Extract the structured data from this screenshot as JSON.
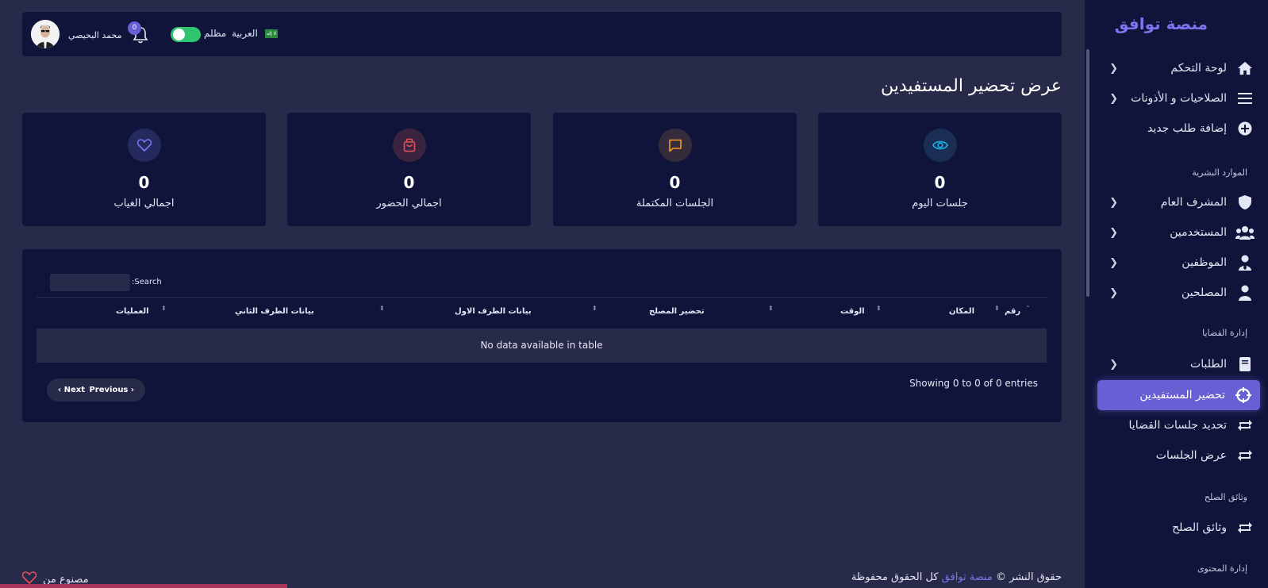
{
  "sidebar": {
    "brand": "منصة توافق",
    "items": [
      {
        "label": "لوحة التحكم",
        "icon": "home-icon"
      },
      {
        "label": "الصلاحيات و الأذونات",
        "icon": "menu-icon"
      },
      {
        "label": "إضافة طلب جديد",
        "icon": "plus-circle-icon"
      },
      {
        "label": "المشرف العام",
        "icon": "shield-icon"
      },
      {
        "label": "المستخدمين",
        "icon": "users-icon"
      },
      {
        "label": "الموظفين",
        "icon": "user-tie-icon"
      },
      {
        "label": "المصلحين",
        "icon": "user-icon"
      },
      {
        "label": "الطلبات",
        "icon": "book-icon"
      },
      {
        "label": "تحضير المستفيدين",
        "icon": "crosshair-icon"
      },
      {
        "label": "تحديد جلسات القضايا",
        "icon": "repeat-icon"
      },
      {
        "label": "عرض الجلسات",
        "icon": "repeat-icon"
      },
      {
        "label": "وثائق الصلح",
        "icon": "repeat-icon"
      }
    ],
    "sections": [
      "الموارد البشرية",
      "إدارة القضايا",
      "وثائق الصلح",
      "إدارة المحتوى"
    ]
  },
  "topbar": {
    "user_name": "محمد البحيصي",
    "notifications_count": "0",
    "dark_mode_label": "مظلم",
    "dark_mode_on": true,
    "language_label": "العربية",
    "flag_text": "لا إله"
  },
  "page": {
    "title": "عرض تحضير المستفيدين"
  },
  "stats": [
    {
      "label": "جلسات اليوم",
      "value": "0",
      "icon": "eye-icon",
      "color": "#19b4e8"
    },
    {
      "label": "الجلسات المكتملة",
      "value": "0",
      "icon": "chat-icon",
      "color": "#f39a2b"
    },
    {
      "label": "اجمالي الحضور",
      "value": "0",
      "icon": "bag-icon",
      "color": "#e8505b"
    },
    {
      "label": "اجمالي الغياب",
      "value": "0",
      "icon": "heart-icon",
      "color": "#7c74f0"
    }
  ],
  "table": {
    "search_label": ":Search",
    "search_value": "",
    "columns": [
      "رقم",
      "المكان",
      "الوقت",
      "تحضير المصلح",
      "بيانات الطرف الاول",
      "بيانات الطرف الثاني",
      "العمليات"
    ],
    "empty_text": "No data available in table",
    "info": "Showing 0 to 0 of 0 entries",
    "pager": {
      "previous": "Previous",
      "next": "Next"
    }
  },
  "footer": {
    "copyright_prefix": "حقوق النشر ©",
    "brand_link": "منصة توافق",
    "rights": "كل الحقوق محفوظة",
    "made_by": "مصنوع من"
  }
}
